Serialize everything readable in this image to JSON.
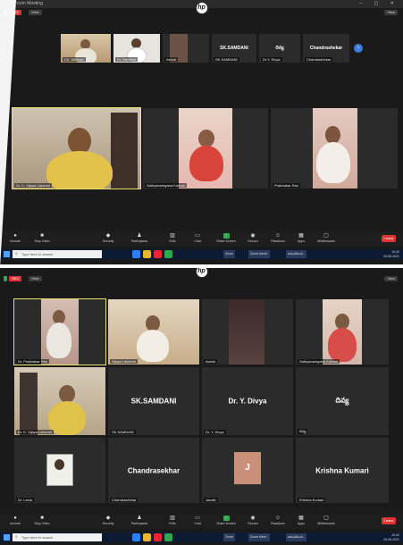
{
  "top": {
    "window_title": "Zoom Meeting",
    "rec_label": "REC",
    "view_label": "View",
    "gallery_label": "View",
    "strip": [
      {
        "name": "Ch. Srinivas"
      },
      {
        "name": "Dr. Ramesh"
      },
      {
        "name": "Ashok"
      },
      {
        "name": "SK.SAMDANI",
        "center": "SK.SAMDANI"
      },
      {
        "name": "Dr.Y. Divya",
        "center": "దివ్య"
      },
      {
        "name": "Chandrashekar",
        "center": "Chandrashekar"
      }
    ],
    "tiles": [
      {
        "name": "Dr. K. Vijaya Lakshmi"
      },
      {
        "name": "Sathyanarayana Kumari"
      },
      {
        "name": "Prabhakar Rao"
      }
    ],
    "taskbar": {
      "search_placeholder": "Type here to search",
      "apps": [
        "Zoom",
        "Zoom Meeti..",
        "అనువదించు.."
      ],
      "time": "10:42",
      "date": "29-06-2021"
    }
  },
  "bottom": {
    "rec_label": "REC",
    "view_label": "View",
    "gallery_label": "View",
    "tiles": [
      {
        "name": "Dr. Prabhakar Rao"
      },
      {
        "name": "Vijaya Lakshmi"
      },
      {
        "name": "Ashok"
      },
      {
        "name": "Sathyanarayana Kumari"
      },
      {
        "name": "Dr. K. Vijaya Lakshmi"
      },
      {
        "name": "SK.SAMDANI",
        "center": "SK.SAMDANI"
      },
      {
        "name": "Dr. Y. Divya",
        "center": "Dr. Y. Divya"
      },
      {
        "name": "దివ్య",
        "center": "దివ్య"
      },
      {
        "name": "Dr. Leela"
      },
      {
        "name": "Chandrasekhar",
        "center": "Chandrasekhar"
      },
      {
        "name": "Janaki",
        "center": "J"
      },
      {
        "name": "Krishna Kumari",
        "center": "Krishna Kumari"
      }
    ],
    "taskbar": {
      "search_placeholder": "Type here to search",
      "apps": [
        "Zoom",
        "Zoom Meet..",
        "అనువదించు.."
      ],
      "time": "10:42",
      "date": "29-06-2021"
    }
  },
  "toolbar": {
    "items": [
      "Unmute",
      "Stop Video",
      "Security",
      "Participants",
      "Polls",
      "Chat",
      "Share Screen",
      "Record",
      "Reactions",
      "Apps",
      "Whiteboards"
    ],
    "end_label": "Leave"
  },
  "colors": {
    "zoom_bg": "#1a1a1a",
    "tile_bg": "#2b2b2b",
    "active_speaker": "#e8e26a",
    "share_green": "#2fa84f",
    "end_red": "#d33333",
    "taskbar": "#0d1a33"
  },
  "icons": [
    "hp-logo-icon",
    "windows-start-icon",
    "search-icon",
    "microphone-icon",
    "video-camera-icon",
    "shield-icon"
  ]
}
